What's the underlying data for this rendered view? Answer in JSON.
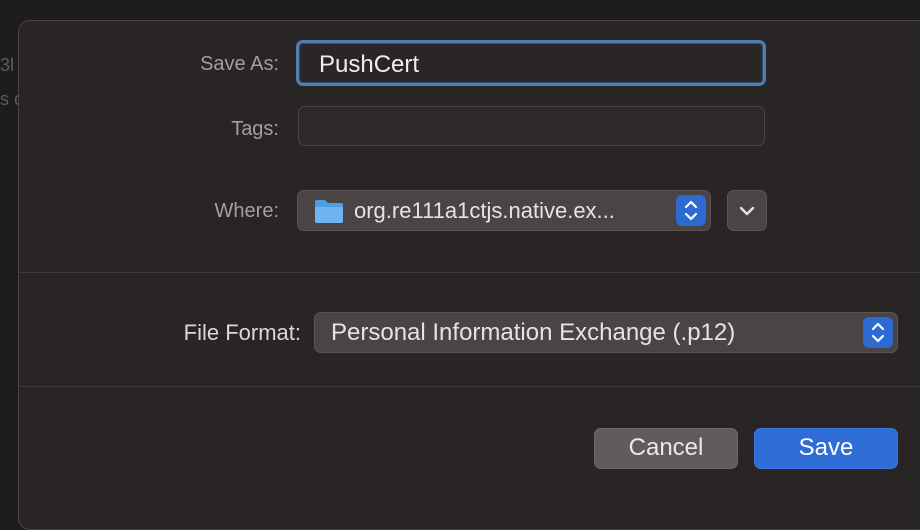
{
  "background": {
    "line1": "3l",
    "line2": "s c"
  },
  "dialog": {
    "save_as": {
      "label": "Save As:",
      "value": "PushCert"
    },
    "tags": {
      "label": "Tags:",
      "value": ""
    },
    "where": {
      "label": "Where:",
      "value": "org.re111a1ctjs.native.ex...",
      "icon": "folder-icon"
    },
    "file_format": {
      "label": "File Format:",
      "value": "Personal Information Exchange (.p12)"
    },
    "buttons": {
      "cancel": "Cancel",
      "save": "Save"
    }
  },
  "colors": {
    "accent": "#2e6cd6",
    "focus_ring": "#4d7eb4",
    "sheet_bg": "#2a2525",
    "folder": "#5aa6e8"
  }
}
